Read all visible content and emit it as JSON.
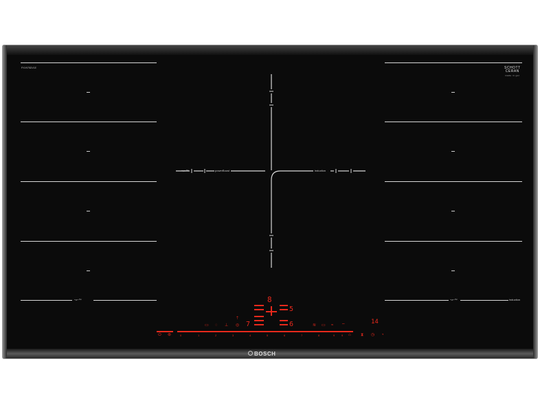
{
  "cooktop": {
    "brand": "BOSCH",
    "glass_brand_line1": "SCHOTT",
    "glass_brand_line2": "CERAN",
    "model_code": "PXV975DV1E",
    "glass_sub": "made in ger",
    "labels": {
      "flex_left_bottom": "ᴖᴧᴖ™",
      "flex_center_left": "ᴖᴧᴖ™",
      "powerboost": "powerBoost",
      "induction_center": "induction",
      "flex_right_bottom": "ᴖᴧᴖ™",
      "induction_right": "induction"
    },
    "displays": {
      "main_level": "8",
      "level_upper": "5",
      "level_lower": "6",
      "center_small": "7",
      "timer": "14"
    },
    "slider_numbers": [
      "0",
      "1",
      "2",
      "3",
      "4",
      "5",
      "6",
      "7",
      "8",
      "9",
      "9"
    ],
    "colors": {
      "glass": "#0b0b0b",
      "lines": "#d9d9d9",
      "indicator_red": "#e8291c"
    }
  }
}
